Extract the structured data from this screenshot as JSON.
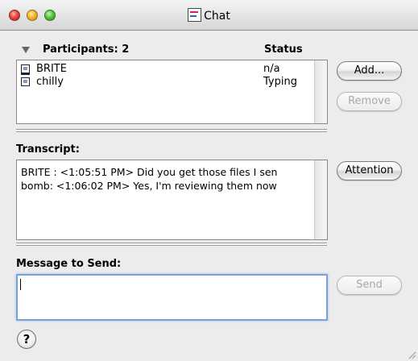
{
  "window": {
    "title": "Chat"
  },
  "participants": {
    "header_label": "Participants: 2",
    "status_header": "Status",
    "rows": [
      {
        "name": "BRITE",
        "status": "n/a",
        "icon": "computer-icon"
      },
      {
        "name": "chilly",
        "status": "Typing",
        "icon": "handheld-icon"
      }
    ],
    "add_label": "Add...",
    "remove_label": "Remove"
  },
  "transcript": {
    "label": "Transcript:",
    "lines": [
      "BRITE : <1:05:51 PM> Did you get those files I sen",
      "bomb: <1:06:02 PM> Yes, I'm reviewing them now"
    ],
    "attention_label": "Attention"
  },
  "message": {
    "label": "Message to Send:",
    "value": "",
    "send_label": "Send"
  },
  "help": {
    "glyph": "?"
  }
}
